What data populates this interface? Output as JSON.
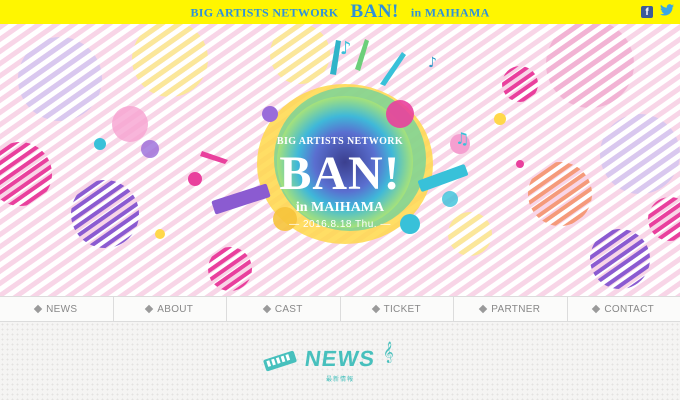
{
  "topbar": {
    "title_left": "BIG ARTISTS NETWORK",
    "title_main": "BAN!",
    "title_right": "in MAIHAMA",
    "background": "#fff600",
    "text_color": "#2f91d8",
    "facebook_icon": "facebook-icon",
    "twitter_icon": "twitter-icon"
  },
  "hero": {
    "logo_line1": "BIG ARTISTS NETWORK",
    "logo_main": "BAN!",
    "logo_sub": "in MAIHAMA",
    "logo_date": "— 2016.8.18 Thu. —",
    "accent_colors": [
      "#f06bb5",
      "#ffe24a",
      "#38c1d9",
      "#7a5bd6",
      "#f59fd0"
    ]
  },
  "nav": {
    "items": [
      {
        "label": "NEWS"
      },
      {
        "label": "ABOUT"
      },
      {
        "label": "CAST"
      },
      {
        "label": "TICKET"
      },
      {
        "label": "PARTNER"
      },
      {
        "label": "CONTACT"
      }
    ]
  },
  "news": {
    "title": "NEWS",
    "subtitle": "最新情報",
    "accent": "#47c0bd"
  }
}
